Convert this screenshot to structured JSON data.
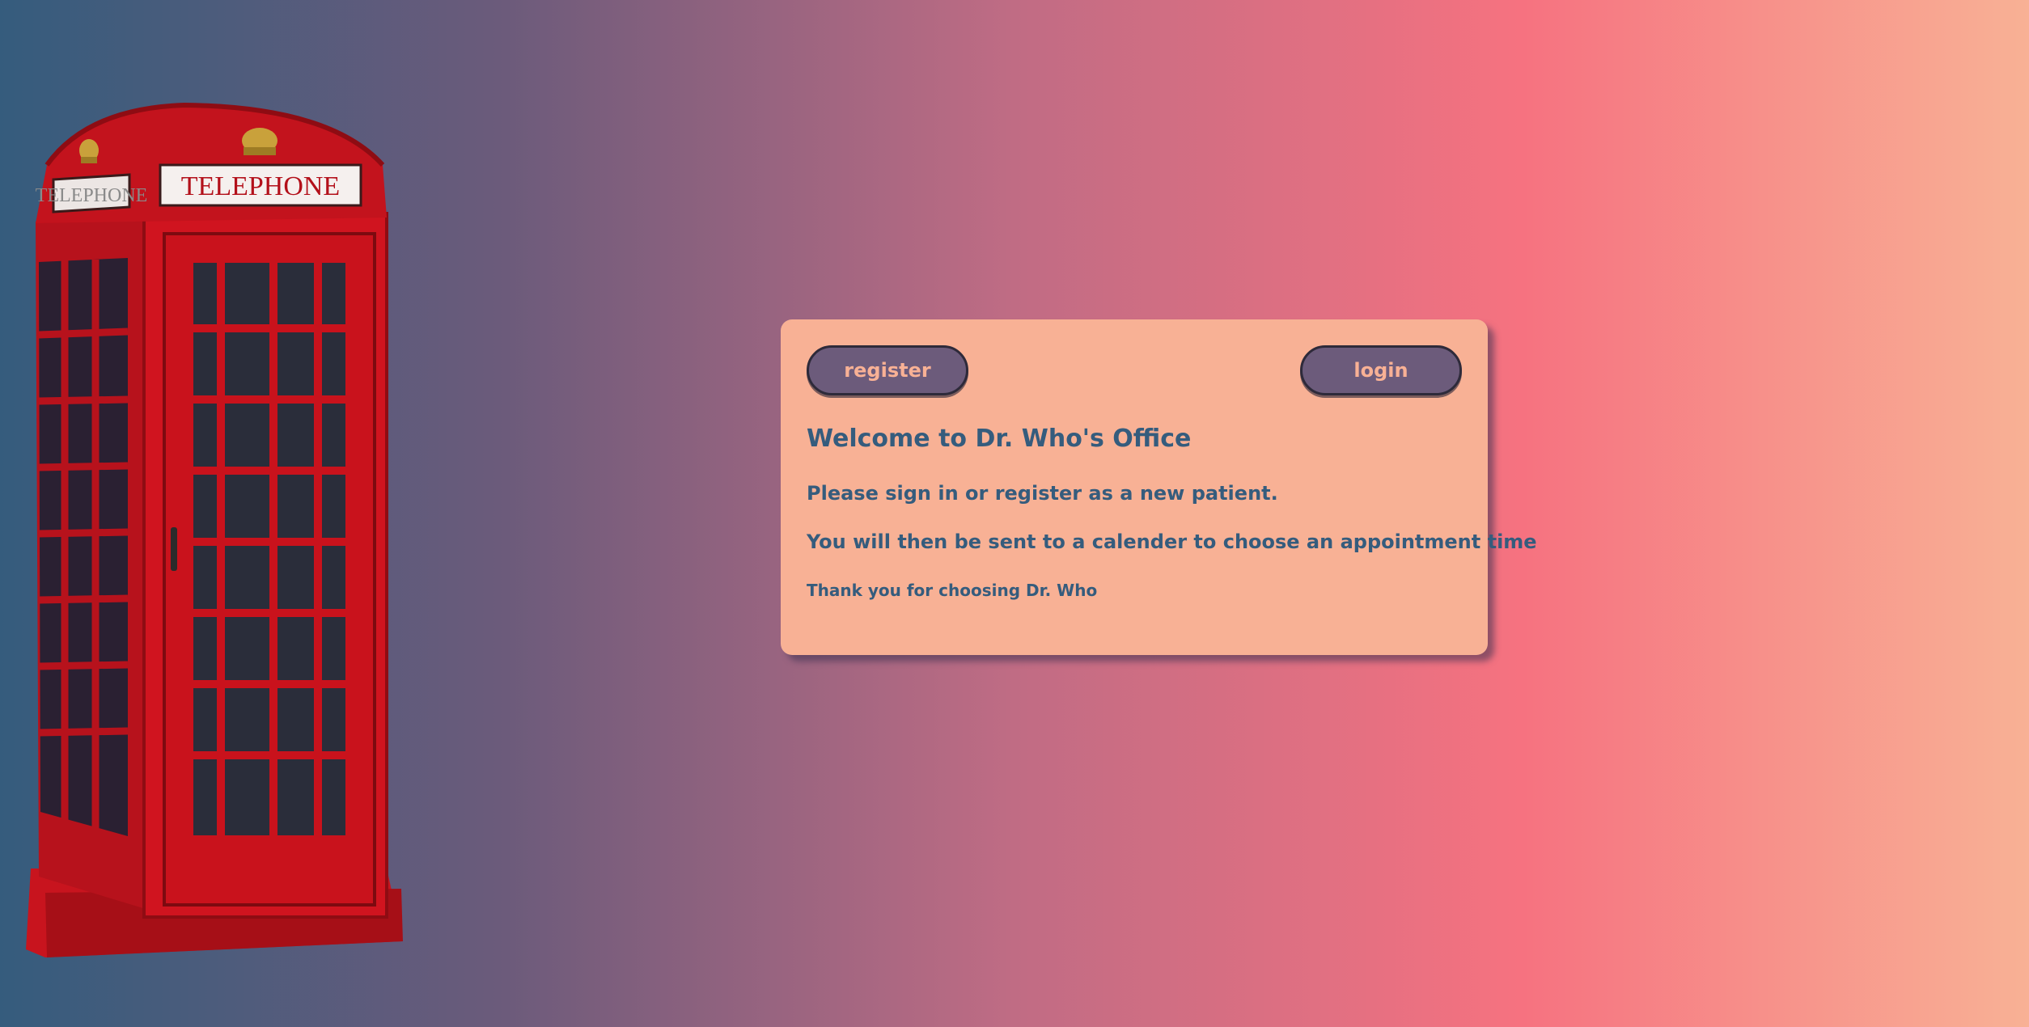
{
  "booth": {
    "sign_left": "TELEPHONE",
    "sign_front": "TELEPHONE"
  },
  "card": {
    "register_label": "register",
    "login_label": "login",
    "title": "Welcome to Dr. Who's Office",
    "line1": "Please sign in or register as a new patient.",
    "line2": "You will then be sent to a calender to choose an appointment time",
    "thanks": "Thank you for choosing Dr. Who"
  },
  "colors": {
    "gradient": [
      "#355c7d",
      "#6c5b7b",
      "#c06c84",
      "#f67280",
      "#f8b195"
    ],
    "card_bg": "#f8b195",
    "button_bg": "#6c5b7b",
    "text": "#355c7d"
  }
}
